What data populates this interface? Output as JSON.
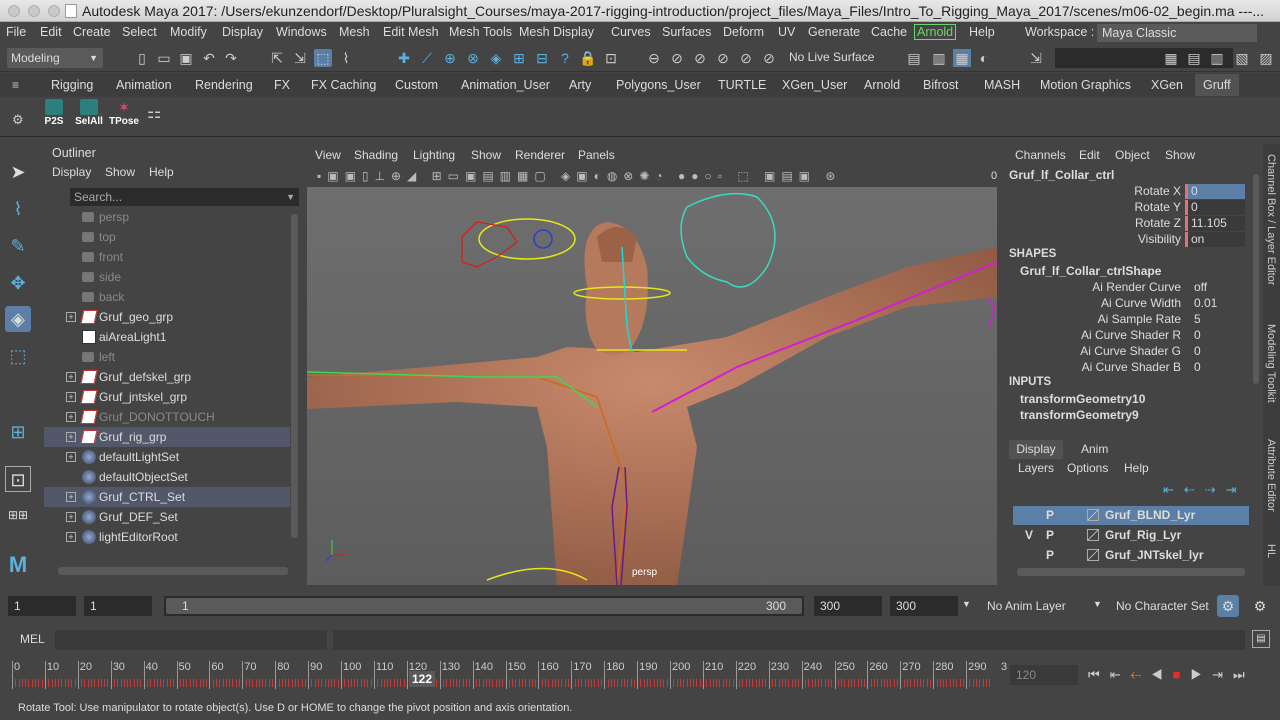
{
  "titlebar": {
    "title": "Autodesk Maya 2017: /Users/ekunzendorf/Desktop/Pluralsight_Courses/maya-2017-rigging-introduction/project_files/Maya_Files/Intro_To_Rigging_Maya_2017/scenes/m06-02_begin.ma  ---..."
  },
  "menubar": {
    "items": [
      "File",
      "Edit",
      "Create",
      "Select",
      "Modify",
      "Display",
      "Windows",
      "Mesh",
      "Edit Mesh",
      "Mesh Tools",
      "Mesh Display",
      "Curves",
      "Surfaces",
      "Deform",
      "UV",
      "Generate",
      "Cache",
      "Arnold",
      "Help"
    ],
    "workspace_label": "Workspace :",
    "workspace_value": "Maya Classic"
  },
  "statusline": {
    "mode": "Modeling",
    "live_surface": "No Live Surface"
  },
  "shelf_tabs": [
    "Rigging",
    "Animation",
    "Rendering",
    "FX",
    "FX Caching",
    "Custom",
    "Animation_User",
    "Arty",
    "Polygons_User",
    "TURTLE",
    "XGen_User",
    "Arnold",
    "Bifrost",
    "MASH",
    "Motion Graphics",
    "XGen",
    "Gruff"
  ],
  "shelf_buttons": [
    "P2S",
    "SelAll",
    "TPose"
  ],
  "outliner": {
    "title": "Outliner",
    "menus": [
      "Display",
      "Show",
      "Help"
    ],
    "search_placeholder": "Search...",
    "rows": [
      {
        "label": "persp",
        "dim": true,
        "icon": "camera"
      },
      {
        "label": "top",
        "dim": true,
        "icon": "camera"
      },
      {
        "label": "front",
        "dim": true,
        "icon": "camera"
      },
      {
        "label": "side",
        "dim": true,
        "icon": "camera"
      },
      {
        "label": "back",
        "dim": true,
        "icon": "camera"
      },
      {
        "label": "Gruf_geo_grp",
        "dim": false,
        "icon": "group",
        "exp": true
      },
      {
        "label": "aiAreaLight1",
        "dim": false,
        "icon": "light"
      },
      {
        "label": "left",
        "dim": true,
        "icon": "camera"
      },
      {
        "label": "Gruf_defskel_grp",
        "dim": false,
        "icon": "group",
        "exp": true
      },
      {
        "label": "Gruf_jntskel_grp",
        "dim": false,
        "icon": "group",
        "exp": true
      },
      {
        "label": "Gruf_DONOTTOUCH",
        "dim": true,
        "icon": "group",
        "exp": true
      },
      {
        "label": "Gruf_rig_grp",
        "dim": false,
        "icon": "group",
        "exp": true,
        "sel": true
      },
      {
        "label": "defaultLightSet",
        "dim": false,
        "icon": "set",
        "exp": true
      },
      {
        "label": "defaultObjectSet",
        "dim": false,
        "icon": "set"
      },
      {
        "label": "Gruf_CTRL_Set",
        "dim": false,
        "icon": "set",
        "exp": true,
        "sel": true
      },
      {
        "label": "Gruf_DEF_Set",
        "dim": false,
        "icon": "set",
        "exp": true
      },
      {
        "label": "lightEditorRoot",
        "dim": false,
        "icon": "set",
        "exp": true
      }
    ]
  },
  "viewport": {
    "menus": [
      "View",
      "Shading",
      "Lighting",
      "Show",
      "Renderer",
      "Panels"
    ],
    "camera_label": "persp",
    "hud_zero": "0"
  },
  "channelbox": {
    "menus": [
      "Channels",
      "Edit",
      "Object",
      "Show"
    ],
    "object": "Gruf_lf_Collar_ctrl",
    "channels": [
      {
        "label": "Rotate X",
        "value": "0",
        "hl": true
      },
      {
        "label": "Rotate Y",
        "value": "0"
      },
      {
        "label": "Rotate Z",
        "value": "11.105"
      },
      {
        "label": "Visibility",
        "value": "on"
      }
    ],
    "shapes_header": "SHAPES",
    "shape_name": "Gruf_lf_Collar_ctrlShape",
    "shape_attrs": [
      {
        "label": "Ai Render Curve",
        "value": "off"
      },
      {
        "label": "Ai Curve Width",
        "value": "0.01"
      },
      {
        "label": "Ai Sample Rate",
        "value": "5"
      },
      {
        "label": "Ai Curve Shader R",
        "value": "0"
      },
      {
        "label": "Ai Curve Shader G",
        "value": "0"
      },
      {
        "label": "Ai Curve Shader B",
        "value": "0"
      }
    ],
    "inputs_header": "INPUTS",
    "inputs": [
      "transformGeometry10",
      "transformGeometry9"
    ]
  },
  "layer": {
    "tabs": [
      "Display",
      "Anim"
    ],
    "menus": [
      "Layers",
      "Options",
      "Help"
    ],
    "rows": [
      {
        "v": "",
        "p": "P",
        "name": "Gruf_BLND_Lyr",
        "sel": true
      },
      {
        "v": "V",
        "p": "P",
        "name": "Gruf_Rig_Lyr"
      },
      {
        "v": "",
        "p": "P",
        "name": "Gruf_JNTskel_lyr"
      }
    ]
  },
  "right_strip": [
    "Channel Box / Layer Editor",
    "Modeling Toolkit",
    "Attribute Editor",
    "HL"
  ],
  "range": {
    "start": "1",
    "start2": "1",
    "slider_start": "1",
    "slider_end": "300",
    "end": "300",
    "end2": "300",
    "anim_layer": "No Anim Layer",
    "char_set": "No Character Set"
  },
  "mel": {
    "label": "MEL"
  },
  "timeslider": {
    "ticks": [
      "0",
      "10",
      "20",
      "30",
      "40",
      "50",
      "60",
      "70",
      "80",
      "90",
      "100",
      "110",
      "120",
      "130",
      "140",
      "150",
      "160",
      "170",
      "180",
      "190",
      "200",
      "210",
      "220",
      "230",
      "240",
      "250",
      "260",
      "270",
      "280",
      "290",
      "3"
    ],
    "current": "122",
    "current_field": "120"
  },
  "helpline": "Rotate Tool: Use manipulator to rotate object(s). Use D or HOME to change the pivot position and axis orientation."
}
